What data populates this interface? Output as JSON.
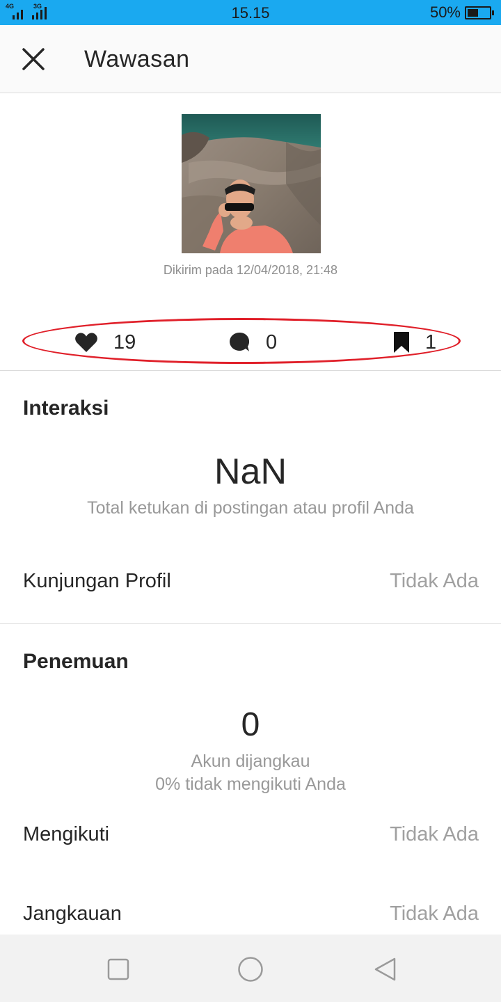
{
  "status_bar": {
    "network_1": "4G",
    "network_2": "3G",
    "time": "15.15",
    "battery_text": "50%",
    "battery_level": 0.5
  },
  "header": {
    "title": "Wawasan",
    "close_icon": "close-icon"
  },
  "post": {
    "posted_text": "Dikirim pada 12/04/2018, 21:48"
  },
  "stats": {
    "likes": "19",
    "comments": "0",
    "saves": "1",
    "highlight_color": "#e0202a"
  },
  "interaksi": {
    "title": "Interaksi",
    "value": "NaN",
    "caption": "Total ketukan di postingan atau profil Anda",
    "rows": [
      {
        "label": "Kunjungan Profil",
        "value": "Tidak Ada"
      }
    ]
  },
  "penemuan": {
    "title": "Penemuan",
    "value": "0",
    "caption_1": "Akun dijangkau",
    "caption_2": "0% tidak mengikuti Anda",
    "rows": [
      {
        "label": "Mengikuti",
        "value": "Tidak Ada"
      },
      {
        "label": "Jangkauan",
        "value": "Tidak Ada"
      }
    ]
  },
  "nav": {
    "recent_icon": "square-icon",
    "home_icon": "circle-icon",
    "back_icon": "triangle-back-icon"
  },
  "colors": {
    "status_bar": "#1aa9f0",
    "text_primary": "#262626",
    "text_secondary": "#999999"
  }
}
